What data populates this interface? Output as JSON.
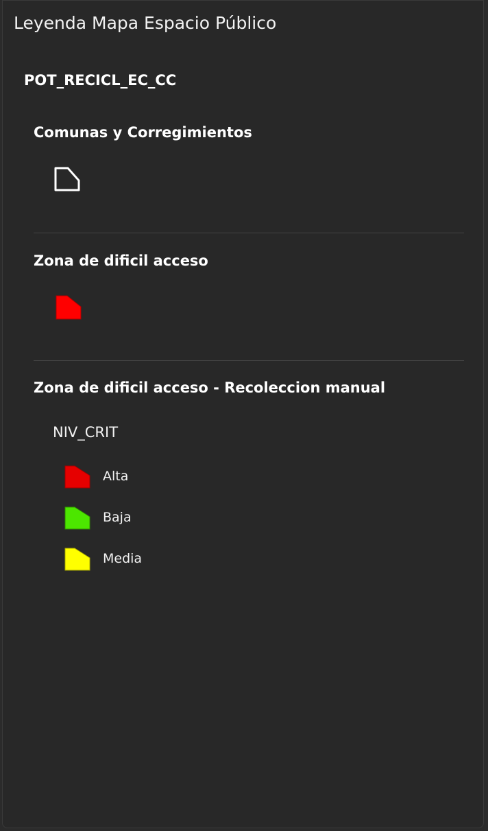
{
  "legend": {
    "title": "Leyenda Mapa Espacio Público",
    "service": "POT_RECICL_EC_CC",
    "layers": [
      {
        "title": "Comunas y Corregimientos",
        "symbol": {
          "icon": "polygon-outline-icon",
          "fill": "none",
          "stroke": "#ffffff"
        }
      },
      {
        "title": "Zona de dificil acceso",
        "symbol": {
          "icon": "polygon-filled-icon",
          "fill": "#ff0000",
          "stroke": "#aa0000"
        }
      },
      {
        "title": "Zona de dificil acceso - Recoleccion manual",
        "field": "NIV_CRIT",
        "classes": [
          {
            "label": "Alta",
            "icon": "polygon-filled-icon",
            "fill": "#e60000",
            "stroke": "#9e0000"
          },
          {
            "label": "Baja",
            "icon": "polygon-filled-icon",
            "fill": "#4ce600",
            "stroke": "#2e8a00"
          },
          {
            "label": "Media",
            "icon": "polygon-filled-icon",
            "fill": "#ffff00",
            "stroke": "#a8a800"
          }
        ]
      }
    ]
  }
}
